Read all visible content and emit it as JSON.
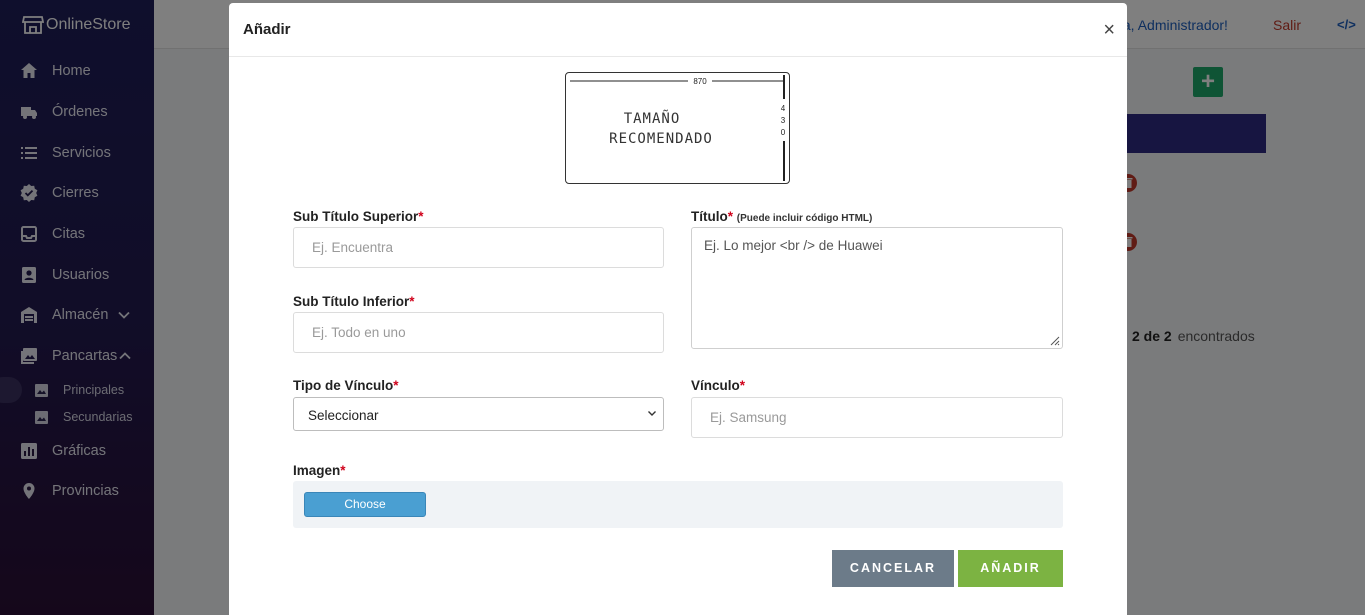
{
  "sidebar": {
    "brand": "OnlineStore",
    "items": [
      {
        "label": "Home",
        "icon": "home-icon"
      },
      {
        "label": "Órdenes",
        "icon": "truck-icon"
      },
      {
        "label": "Servicios",
        "icon": "list-icon"
      },
      {
        "label": "Cierres",
        "icon": "check-badge-icon"
      },
      {
        "label": "Citas",
        "icon": "inbox-icon"
      },
      {
        "label": "Usuarios",
        "icon": "user-card-icon"
      },
      {
        "label": "Almacén",
        "icon": "warehouse-icon"
      },
      {
        "label": "Pancartas",
        "icon": "images-icon"
      },
      {
        "label": "Gráficas",
        "icon": "chart-icon"
      },
      {
        "label": "Provincias",
        "icon": "map-pin-icon"
      }
    ],
    "subitems": [
      {
        "label": "Principales",
        "icon": "image-icon"
      },
      {
        "label": "Secundarias",
        "icon": "image-icon"
      }
    ]
  },
  "topbar": {
    "greeting": "ola, Administrador!",
    "logout": "Salir",
    "code_icon": "</>"
  },
  "background": {
    "add_icon": "+",
    "found_count": "2 de 2",
    "found_suffix": "encontrados"
  },
  "modal": {
    "title": "Añadir",
    "close": "×",
    "hint": {
      "width_label": "870",
      "height_digits": [
        "4",
        "3",
        "0"
      ],
      "line1": "TAMAÑO",
      "line2": "RECOMENDADO"
    },
    "fields": {
      "sub_sup": {
        "label": "Sub Título Superior",
        "required": "*",
        "placeholder": "Ej. Encuentra"
      },
      "sub_inf": {
        "label": "Sub Título Inferior",
        "required": "*",
        "placeholder": "Ej. Todo en uno"
      },
      "titulo": {
        "label": "Título",
        "required": "*",
        "note": "(Puede incluir código HTML)",
        "placeholder": "Ej. Lo mejor <br /> de Huawei"
      },
      "tipo": {
        "label": "Tipo de Vínculo",
        "required": "*",
        "value": "Seleccionar"
      },
      "vinculo": {
        "label": "Vínculo",
        "required": "*",
        "placeholder": "Ej. Samsung"
      },
      "imagen": {
        "label": "Imagen",
        "required": "*",
        "choose": "Choose"
      }
    },
    "buttons": {
      "cancel": "CANCELAR",
      "add": "AÑADIR"
    }
  },
  "colors": {
    "sidebar_top": "#1e1e5a",
    "sidebar_bottom": "#2b0f36",
    "cancel_btn": "#6c7b89",
    "add_btn": "#7cb342",
    "choose_btn": "#4a9fd2",
    "required": "#d0021b"
  }
}
